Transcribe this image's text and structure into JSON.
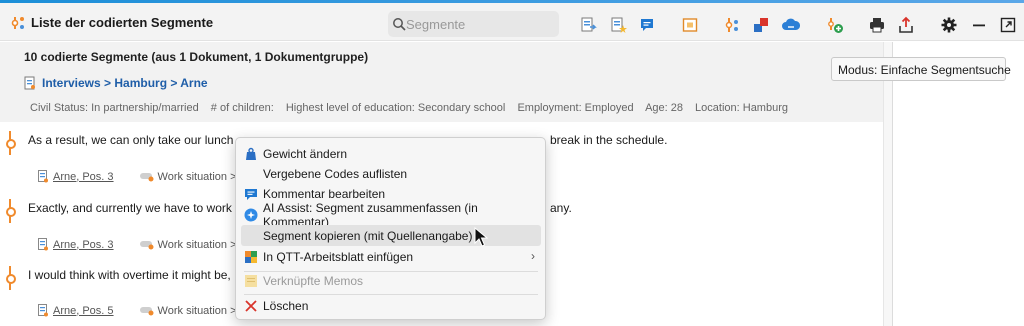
{
  "window": {
    "title": "Liste der codierten Segmente"
  },
  "search": {
    "placeholder": "Segmente"
  },
  "toolbar": {
    "icons": [
      "export-doc-icon",
      "starred-doc-icon",
      "comment-icon",
      "frame-icon",
      "weights-icon",
      "codes-icon",
      "cloud-icon",
      "add-code-icon",
      "print-icon",
      "export-icon",
      "settings-icon",
      "minimize-icon",
      "popout-icon"
    ]
  },
  "summary": {
    "count_text": "10 codierte Segmente (aus 1 Dokument, 1 Dokumentgruppe)"
  },
  "document": {
    "path": "Interviews > Hamburg > Arne",
    "variables": [
      "Civil Status: In partnership/married",
      "# of children:",
      "Highest level of education: Secondary school",
      "Employment: Employed",
      "Age: 28",
      "Location: Hamburg"
    ]
  },
  "segments": [
    {
      "text_start": "As a result, we can only take our lunch",
      "text_end": "break in the schedule.",
      "source": "Arne, Pos. 3",
      "code": "Work situation >"
    },
    {
      "text_start": "Exactly, and currently we have to work",
      "text_end": "any.",
      "source": "Arne, Pos. 3",
      "code": "Work situation >"
    },
    {
      "text_start": "I would think with overtime it might be, I",
      "text_end": "",
      "source": "Arne, Pos. 5",
      "code": "Work situation >"
    }
  ],
  "tooltip": {
    "text": "Modus: Einfache Segmentsuche"
  },
  "context_menu": {
    "items": [
      {
        "label": "Gewicht ändern",
        "icon": "weight-icon"
      },
      {
        "label": "Vergebene Codes auflisten",
        "icon": ""
      },
      {
        "label": "Kommentar bearbeiten",
        "icon": "comment-icon"
      },
      {
        "label": "AI Assist: Segment zusammenfassen (in Kommentar)",
        "icon": "ai-assist-icon"
      },
      {
        "label": "Segment kopieren (mit Quellenangabe)",
        "icon": "",
        "highlighted": true
      },
      {
        "label": "In QTT-Arbeitsblatt einfügen",
        "icon": "qtt-icon",
        "submenu": true
      },
      {
        "label": "Verknüpfte Memos",
        "icon": "memo-icon",
        "disabled": true
      },
      {
        "label": "Löschen",
        "icon": "delete-icon"
      }
    ],
    "submenu_arrow": "›"
  },
  "colors": {
    "accent": "#1f5ea8",
    "segment_bracket": "#f08a2c",
    "delete": "#d9342b",
    "comment": "#1f78d1"
  }
}
